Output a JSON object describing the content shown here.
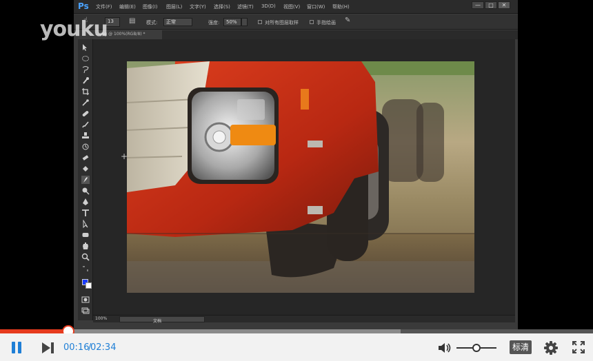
{
  "watermark": {
    "text": "youku"
  },
  "photoshop": {
    "logo": "Ps",
    "menu": [
      "文件(F)",
      "编辑(E)",
      "图像(I)",
      "图层(L)",
      "文字(Y)",
      "选择(S)",
      "滤镜(T)",
      "3D(D)",
      "视图(V)",
      "窗口(W)",
      "帮助(H)"
    ],
    "window_buttons": [
      "—",
      "□",
      "✕"
    ],
    "options": {
      "size_value": "13",
      "mode_label": "模式:",
      "mode_value": "正常",
      "opacity_label": "强度:",
      "opacity_value": "50%",
      "sample_all_label": "对所有图层取样",
      "finger_label": "手指绘画"
    },
    "doc_tab": "….jpg @ 100%(RGB/8) *",
    "status": {
      "zoom": "100%",
      "doc": "文档"
    }
  },
  "player": {
    "time_current": "00:16",
    "time_separator": "/",
    "time_total": "02:34",
    "quality_label": "标清",
    "progress_fraction": 0.115,
    "buffered_fraction": 0.675,
    "volume_fraction": 0.5
  },
  "colors": {
    "accent": "#1f7fd6",
    "progress": "#e63b1e",
    "foreground_swatch": "#1a3bff",
    "background_swatch": "#ffffff"
  },
  "icons": {
    "pause": "pause-icon",
    "next": "next-icon",
    "volume": "volume-icon",
    "settings": "gear-icon",
    "fullscreen": "fullscreen-icon"
  }
}
